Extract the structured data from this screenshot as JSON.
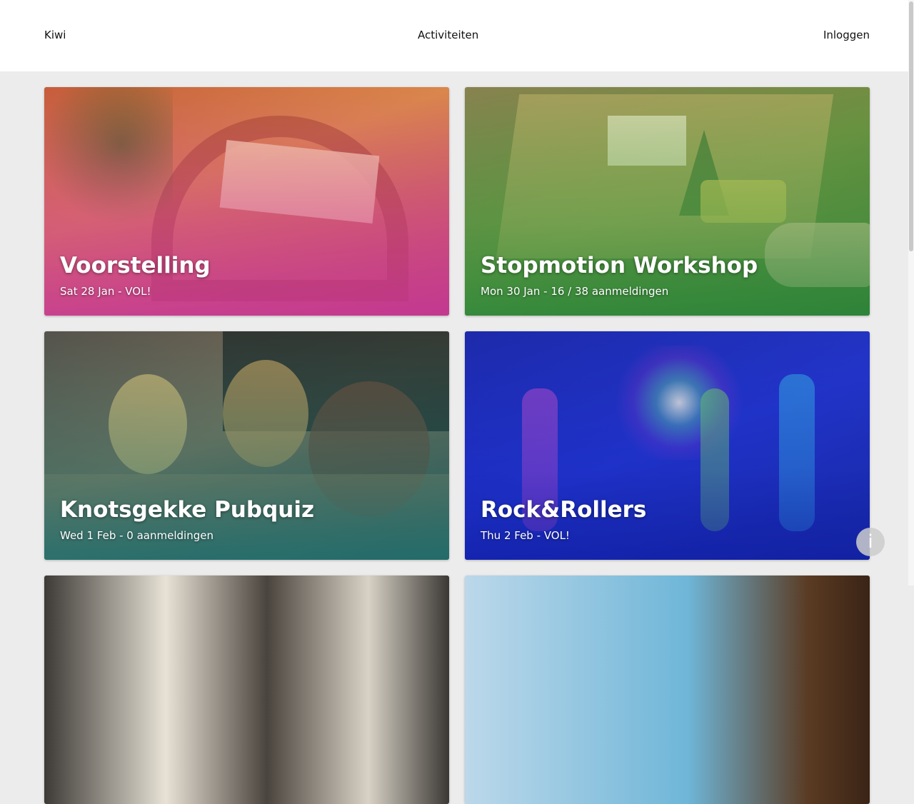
{
  "nav": {
    "brand": "Kiwi",
    "activities": "Activiteiten",
    "login": "Inloggen"
  },
  "events": [
    {
      "title": "Voorstelling",
      "meta": "Sat 28 Jan - VOL!",
      "overlay_color": "#c83aa0"
    },
    {
      "title": "Stopmotion Workshop",
      "meta": "Mon 30 Jan - 16 / 38 aanmeldingen",
      "overlay_color": "#3c9a46"
    },
    {
      "title": "Knotsgekke Pubquiz",
      "meta": "Wed 1 Feb - 0 aanmeldingen",
      "overlay_color": "#0e7a7e"
    },
    {
      "title": "Rock&Rollers",
      "meta": "Thu 2 Feb - VOL!",
      "overlay_color": "#1f2fc0"
    }
  ],
  "info_button": {
    "label": "i"
  }
}
